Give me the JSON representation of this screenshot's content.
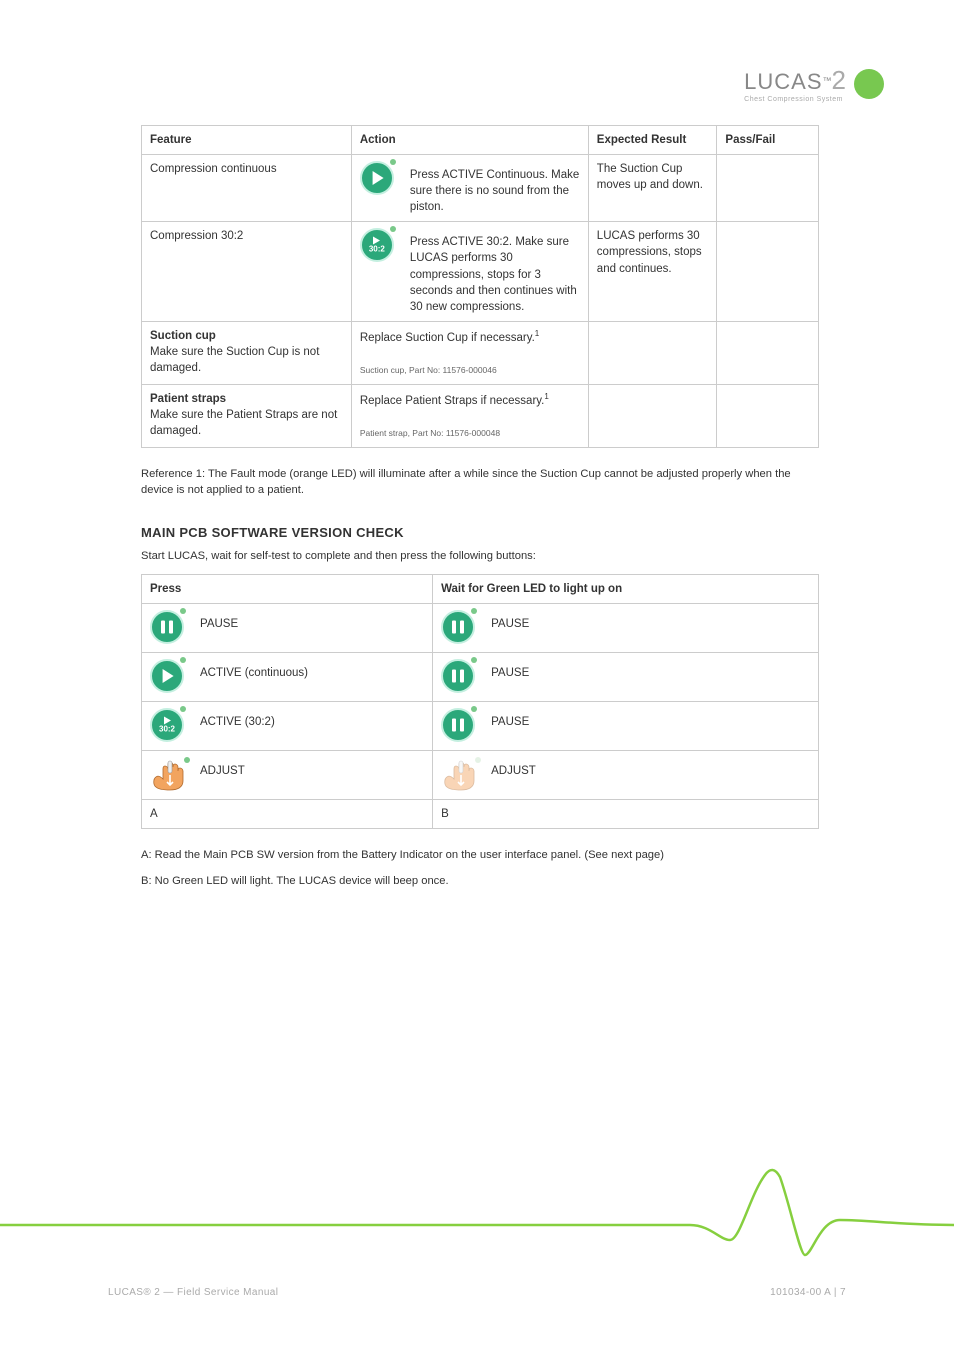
{
  "brand": {
    "name": "LUCAS",
    "tm": "™",
    "version": "2",
    "subtitle": "Chest Compression System"
  },
  "table1": {
    "headers": [
      "Feature",
      "Action",
      "Expected Result",
      "Pass/Fail"
    ],
    "rows": [
      {
        "feature": "Compression continuous",
        "action": "Press ACTIVE Continuous. Make sure there is no sound from the piston.",
        "expected": "The Suction Cup moves up and down.",
        "passfail": ""
      },
      {
        "feature": "Compression 30:2",
        "action": "Press ACTIVE 30:2. Make sure LUCAS performs 30 compressions, stops for 3 seconds and then continues with 30 new compressions.",
        "expected": "LUCAS performs 30 compressions, stops and continues.",
        "passfail": ""
      },
      {
        "feature_title": "Suction cup",
        "feature_body": "Make sure the Suction Cup is not damaged.",
        "action": "Replace Suction Cup if necessary.",
        "action_ref": "Suction cup, Part No: 11576-000046",
        "expected": "",
        "passfail": ""
      },
      {
        "feature_title": "Patient straps",
        "feature_body": "Make sure the Patient Straps are not damaged.",
        "action": "Replace Patient Straps if necessary.",
        "action_ref": "Patient strap, Part No: 11576-000048",
        "expected": "",
        "passfail": ""
      }
    ]
  },
  "footnote1": "Reference 1: The Fault mode (orange LED) will illuminate after a while since the Suction Cup cannot be adjusted properly when the device is not applied to a patient.",
  "section2": {
    "title": "MAIN PCB SOFTWARE VERSION CHECK",
    "intro": "Start LUCAS, wait for self-test to complete and then press the following buttons:",
    "headers": [
      "Press",
      "Wait for Green LED to light up on"
    ],
    "rows": [
      {
        "pressLabel": "PAUSE",
        "waitLabel": "PAUSE",
        "press_icon": "pause",
        "wait_icon": "pause"
      },
      {
        "pressLabel": "ACTIVE (continuous)",
        "waitLabel": "PAUSE",
        "press_icon": "play",
        "wait_icon": "pause"
      },
      {
        "pressLabel": "ACTIVE (30:2)",
        "waitLabel": "PAUSE",
        "press_icon": "302",
        "wait_icon": "pause"
      },
      {
        "pressLabel": "ADJUST",
        "waitLabel": "ADJUST",
        "press_icon": "adjust",
        "wait_icon": "adjust_dim"
      },
      {
        "pressLabel": "A",
        "waitLabel": "B"
      }
    ],
    "note1": "A: Read the Main PCB SW version from the Battery Indicator on the user interface panel. (See next page)",
    "note2": "B: No Green LED will light. The LUCAS device will beep once."
  },
  "footer": {
    "left": "LUCAS® 2 — Field Service Manual",
    "right": "101034-00 A | 7"
  }
}
